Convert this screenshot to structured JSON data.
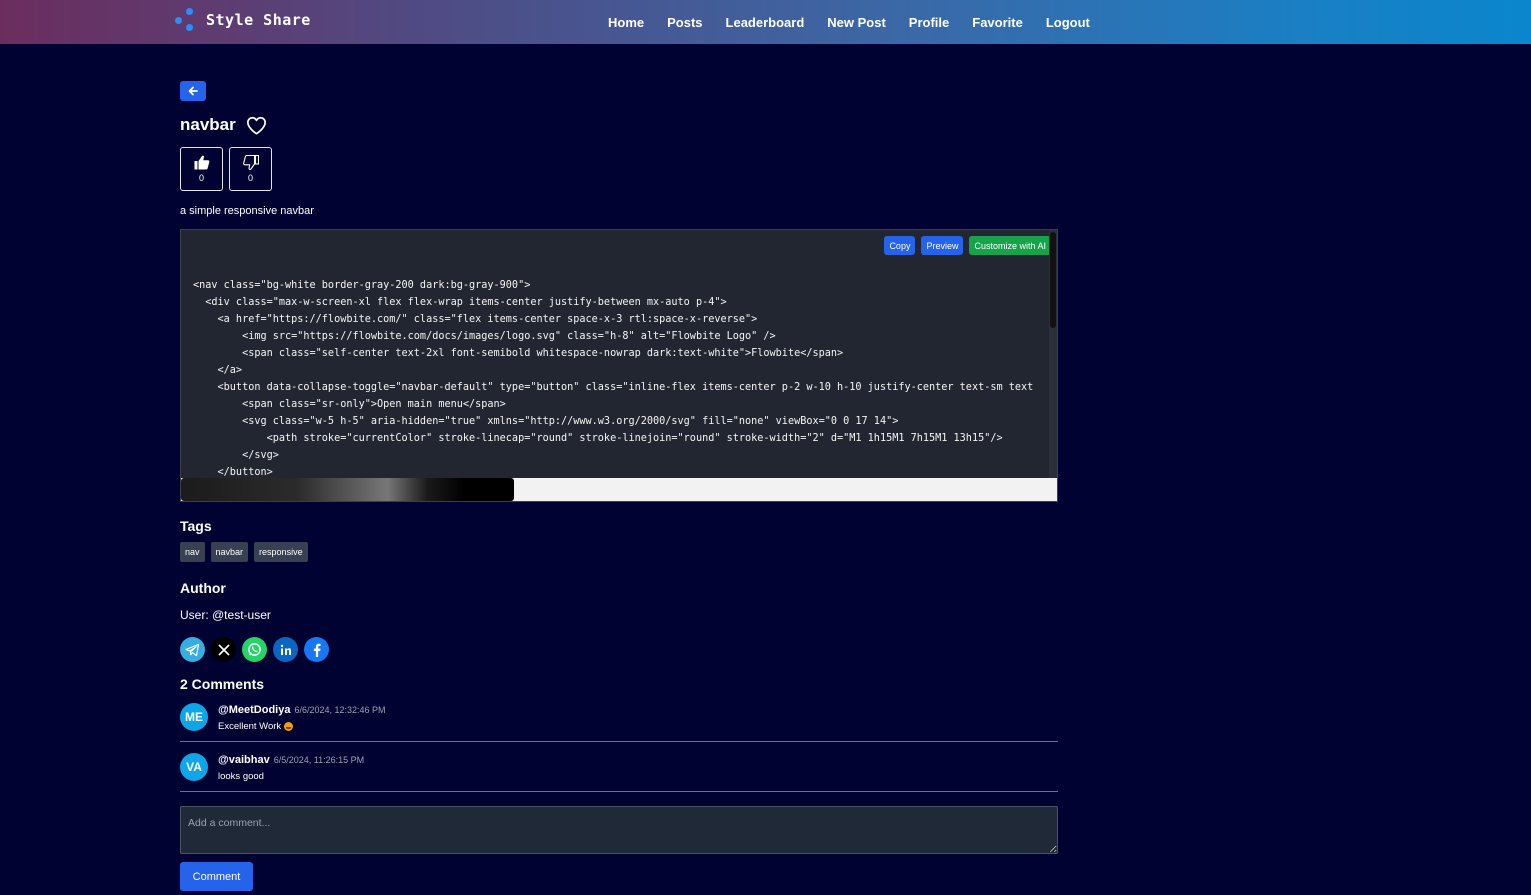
{
  "brand": {
    "name": "Style Share",
    "logo_icon": "share-nodes-icon"
  },
  "nav": {
    "items": [
      "Home",
      "Posts",
      "Leaderboard",
      "New Post",
      "Profile",
      "Favorite",
      "Logout"
    ]
  },
  "post": {
    "back_icon": "arrow-left-icon",
    "title": "navbar",
    "favorite_icon": "heart-outline-icon",
    "upvotes": "0",
    "downvotes": "0",
    "description": "a simple responsive navbar"
  },
  "code": {
    "buttons": {
      "copy": "Copy",
      "preview": "Preview",
      "customize": "Customize with AI"
    },
    "lines": [
      "<nav class=\"bg-white border-gray-200 dark:bg-gray-900\">",
      "  <div class=\"max-w-screen-xl flex flex-wrap items-center justify-between mx-auto p-4\">",
      "    <a href=\"https://flowbite.com/\" class=\"flex items-center space-x-3 rtl:space-x-reverse\">",
      "        <img src=\"https://flowbite.com/docs/images/logo.svg\" class=\"h-8\" alt=\"Flowbite Logo\" />",
      "        <span class=\"self-center text-2xl font-semibold whitespace-nowrap dark:text-white\">Flowbite</span>",
      "    </a>",
      "    <button data-collapse-toggle=\"navbar-default\" type=\"button\" class=\"inline-flex items-center p-2 w-10 h-10 justify-center text-sm text",
      "        <span class=\"sr-only\">Open main menu</span>",
      "        <svg class=\"w-5 h-5\" aria-hidden=\"true\" xmlns=\"http://www.w3.org/2000/svg\" fill=\"none\" viewBox=\"0 0 17 14\">",
      "            <path stroke=\"currentColor\" stroke-linecap=\"round\" stroke-linejoin=\"round\" stroke-width=\"2\" d=\"M1 1h15M1 7h15M1 13h15\"/>",
      "        </svg>",
      "    </button>"
    ]
  },
  "tags": {
    "heading": "Tags",
    "items": [
      "nav",
      "navbar",
      "responsive"
    ]
  },
  "author": {
    "heading": "Author",
    "line": "User: @test-user"
  },
  "share": {
    "icons": [
      "telegram-icon",
      "x-twitter-icon",
      "whatsapp-icon",
      "linkedin-icon",
      "facebook-icon"
    ]
  },
  "comments": {
    "heading": "2 Comments",
    "items": [
      {
        "initials": "ME",
        "user": "@MeetDodiya",
        "time": "6/6/2024, 12:32:46 PM",
        "text": "Excellent Work"
      },
      {
        "initials": "VA",
        "user": "@vaibhav",
        "time": "6/5/2024, 11:26:15 PM",
        "text": "looks good"
      }
    ],
    "placeholder": "Add a comment...",
    "submit_label": "Comment"
  },
  "colors": {
    "background": "#000331",
    "accent": "#2563eb",
    "success": "#16a34a",
    "avatar": "#0ea5e9"
  }
}
